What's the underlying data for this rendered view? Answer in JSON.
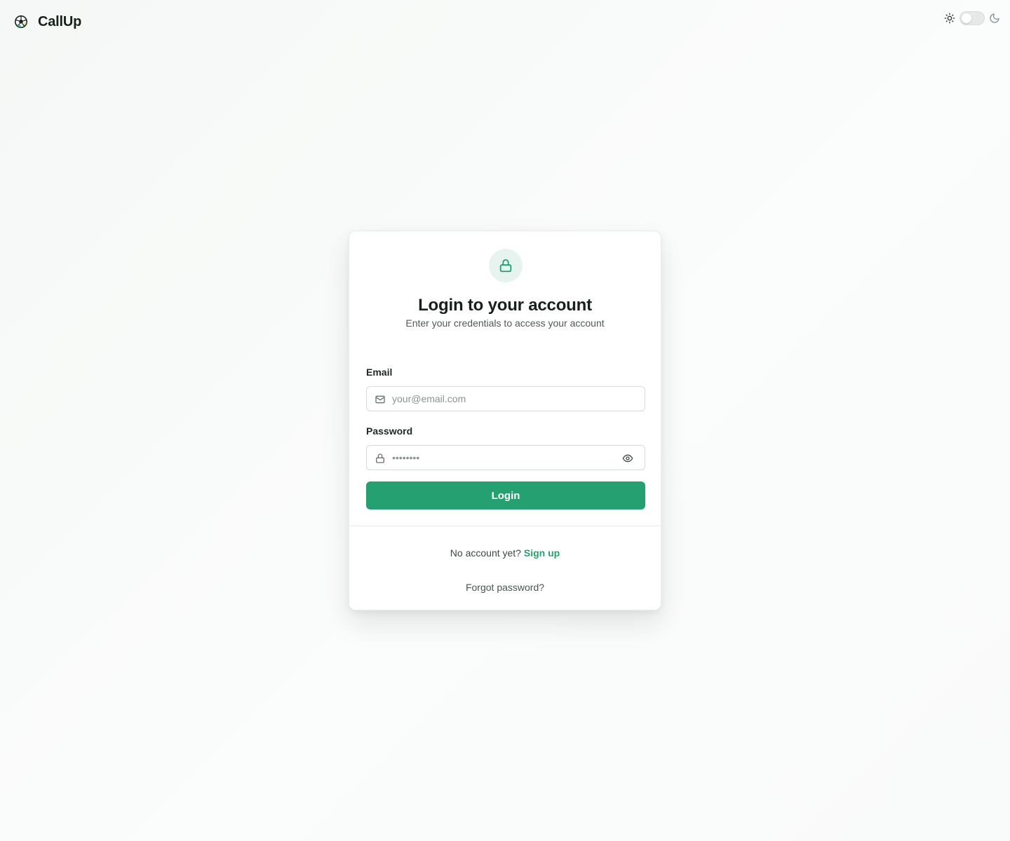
{
  "app": {
    "name": "CallUp",
    "logo_icon": "soccer-ball-icon"
  },
  "theme_toggle": {
    "light_icon": "sun-icon",
    "dark_icon": "moon-icon",
    "dark_mode_enabled": false
  },
  "login_card": {
    "header_icon": "lock-icon",
    "title": "Login to your account",
    "subtitle": "Enter your credentials to access your account",
    "email": {
      "label": "Email",
      "placeholder": "your@email.com",
      "value": "",
      "icon": "mail-icon"
    },
    "password": {
      "label": "Password",
      "placeholder": "••••••••",
      "value": "",
      "icon": "lock-icon",
      "toggle_icon": "eye-icon"
    },
    "submit_label": "Login",
    "signup_prompt": "No account yet?",
    "signup_link": "Sign up",
    "forgot_link": "Forgot password?"
  },
  "colors": {
    "accent": "#24a071",
    "accent_soft": "#e7f3ee",
    "text_primary": "#17211c",
    "text_secondary": "#4f5a55"
  }
}
